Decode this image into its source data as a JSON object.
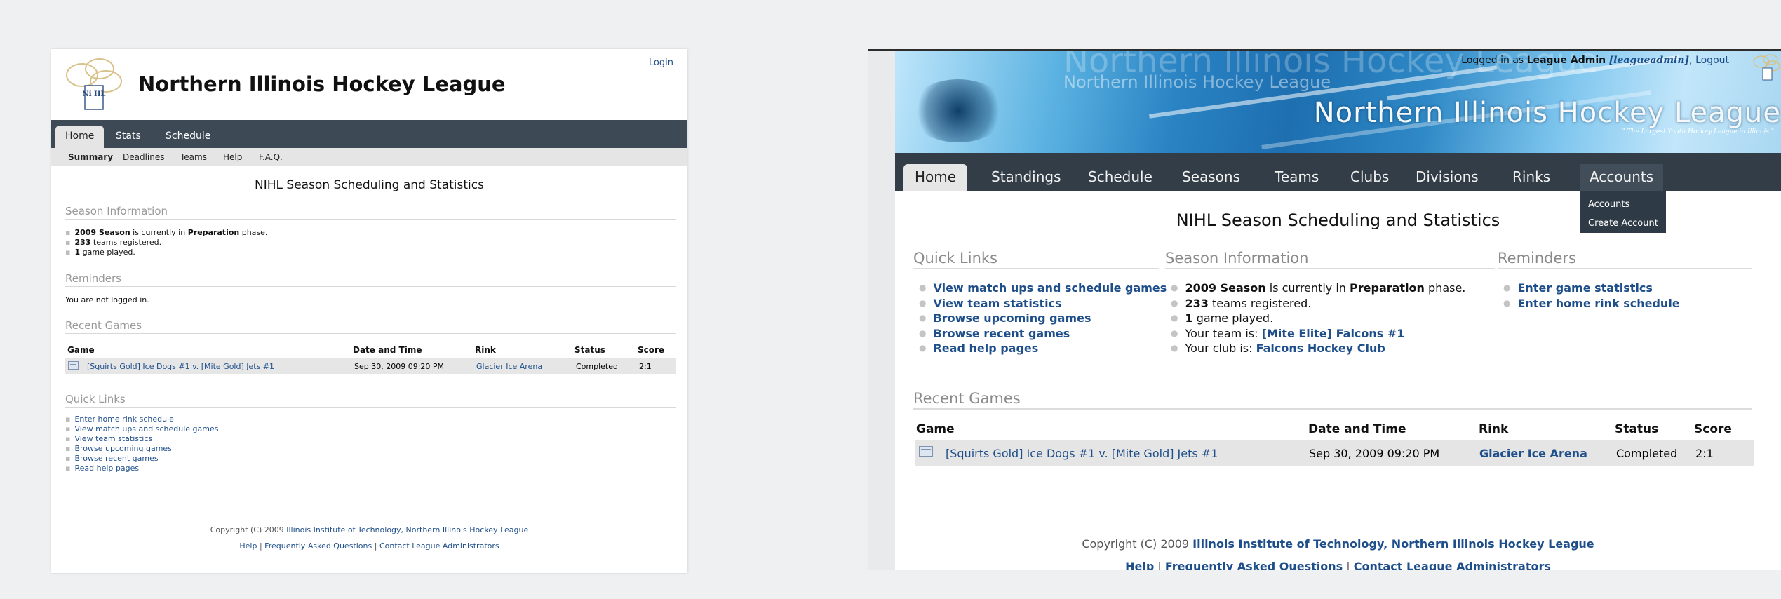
{
  "left": {
    "login": "Login",
    "logo_text": "Ni HL",
    "title": "Northern Illinois Hockey League",
    "tabs": [
      "Home",
      "Stats",
      "Schedule"
    ],
    "subtabs": [
      "Summary",
      "Deadlines",
      "Teams",
      "Help",
      "F.A.Q."
    ],
    "page_heading": "NIHL Season Scheduling and Statistics",
    "season_info": {
      "heading": "Season Information",
      "season_bold": "2009 Season",
      "season_mid": " is currently in ",
      "phase": "Preparation",
      "season_end": " phase.",
      "teams_num": "233",
      "teams_text": " teams registered.",
      "games_num": "1",
      "games_text": " game played."
    },
    "reminders": {
      "heading": "Reminders",
      "text": "You are not logged in."
    },
    "recent_games": {
      "heading": "Recent Games",
      "columns": [
        "Game",
        "Date and Time",
        "Rink",
        "Status",
        "Score"
      ],
      "row": {
        "game": "[Squirts Gold] Ice Dogs #1 v. [Mite Gold] Jets #1",
        "date": "Sep 30, 2009 09:20 PM",
        "rink": "Glacier Ice Arena",
        "status": "Completed",
        "score": "2:1"
      }
    },
    "quick_links": {
      "heading": "Quick Links",
      "items": [
        "Enter home rink schedule",
        "View match ups and schedule games",
        "View team statistics",
        "Browse upcoming games",
        "Browse recent games",
        "Read help pages"
      ]
    },
    "footer": {
      "copyright_prefix": "Copyright (C) 2009 ",
      "copyright_link": "Illinois Institute of Technology, Northern Illinois Hockey League",
      "help": "Help",
      "faq": "Frequently Asked Questions",
      "contact": "Contact League Administrators",
      "sep": " | "
    }
  },
  "right": {
    "login_prefix": "Logged in as ",
    "login_name": "League Admin",
    "login_user": "[leagueadmin]",
    "logout": "Logout",
    "banner_ghost": "Northern Illinois Hockey League",
    "banner_title": "Northern Illinois Hockey League",
    "banner_tagline": "\" The Largest Youth Hockey League in Illinois \"",
    "tabs": [
      "Home",
      "Standings",
      "Schedule",
      "Seasons",
      "Teams",
      "Clubs",
      "Divisions",
      "Rinks",
      "Accounts"
    ],
    "accounts_menu": [
      "Accounts",
      "Create Account"
    ],
    "page_heading": "NIHL Season Scheduling and Statistics",
    "quick_links": {
      "heading": "Quick Links",
      "items": [
        "View match ups and schedule games",
        "View team statistics",
        "Browse upcoming games",
        "Browse recent games",
        "Read help pages"
      ]
    },
    "season_info": {
      "heading": "Season Information",
      "season_bold": "2009 Season",
      "season_mid": " is currently in ",
      "phase": "Preparation",
      "season_end": " phase.",
      "teams_num": "233",
      "teams_text": " teams registered.",
      "games_num": "1",
      "games_text": " game played.",
      "team_prefix": "Your team is: ",
      "team_link": "[Mite Elite] Falcons #1",
      "club_prefix": "Your club is: ",
      "club_link": "Falcons Hockey Club"
    },
    "reminders": {
      "heading": "Reminders",
      "items": [
        "Enter game statistics",
        "Enter home rink schedule"
      ]
    },
    "recent_games": {
      "heading": "Recent Games",
      "columns": [
        "Game",
        "Date and Time",
        "Rink",
        "Status",
        "Score"
      ],
      "row": {
        "game": "[Squirts Gold] Ice Dogs #1 v. [Mite Gold] Jets #1",
        "date": "Sep 30, 2009 09:20 PM",
        "rink": "Glacier Ice Arena",
        "status": "Completed",
        "score": "2:1"
      }
    },
    "footer": {
      "copyright_prefix": "Copyright (C) 2009 ",
      "copyright_link": "Illinois Institute of Technology, Northern Illinois Hockey League",
      "help": "Help",
      "faq": "Frequently Asked Questions",
      "contact": "Contact League Administrators",
      "sep": " | "
    }
  },
  "colors": {
    "nav_dark": "#323d47",
    "link": "#1f4f8a",
    "row_bg": "#e5e5e5"
  }
}
